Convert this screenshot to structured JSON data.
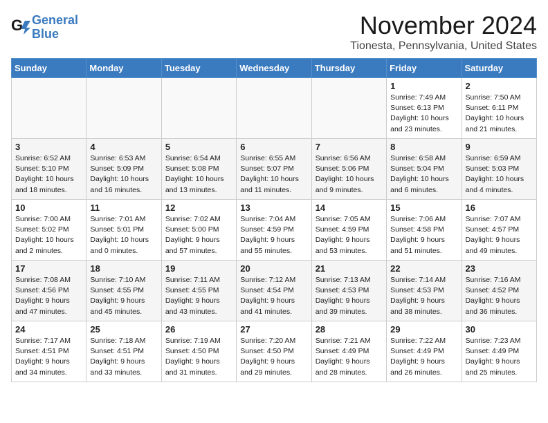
{
  "header": {
    "logo_line1": "General",
    "logo_line2": "Blue",
    "month": "November 2024",
    "location": "Tionesta, Pennsylvania, United States"
  },
  "weekdays": [
    "Sunday",
    "Monday",
    "Tuesday",
    "Wednesday",
    "Thursday",
    "Friday",
    "Saturday"
  ],
  "weeks": [
    [
      {
        "day": "",
        "info": ""
      },
      {
        "day": "",
        "info": ""
      },
      {
        "day": "",
        "info": ""
      },
      {
        "day": "",
        "info": ""
      },
      {
        "day": "",
        "info": ""
      },
      {
        "day": "1",
        "info": "Sunrise: 7:49 AM\nSunset: 6:13 PM\nDaylight: 10 hours\nand 23 minutes."
      },
      {
        "day": "2",
        "info": "Sunrise: 7:50 AM\nSunset: 6:11 PM\nDaylight: 10 hours\nand 21 minutes."
      }
    ],
    [
      {
        "day": "3",
        "info": "Sunrise: 6:52 AM\nSunset: 5:10 PM\nDaylight: 10 hours\nand 18 minutes."
      },
      {
        "day": "4",
        "info": "Sunrise: 6:53 AM\nSunset: 5:09 PM\nDaylight: 10 hours\nand 16 minutes."
      },
      {
        "day": "5",
        "info": "Sunrise: 6:54 AM\nSunset: 5:08 PM\nDaylight: 10 hours\nand 13 minutes."
      },
      {
        "day": "6",
        "info": "Sunrise: 6:55 AM\nSunset: 5:07 PM\nDaylight: 10 hours\nand 11 minutes."
      },
      {
        "day": "7",
        "info": "Sunrise: 6:56 AM\nSunset: 5:06 PM\nDaylight: 10 hours\nand 9 minutes."
      },
      {
        "day": "8",
        "info": "Sunrise: 6:58 AM\nSunset: 5:04 PM\nDaylight: 10 hours\nand 6 minutes."
      },
      {
        "day": "9",
        "info": "Sunrise: 6:59 AM\nSunset: 5:03 PM\nDaylight: 10 hours\nand 4 minutes."
      }
    ],
    [
      {
        "day": "10",
        "info": "Sunrise: 7:00 AM\nSunset: 5:02 PM\nDaylight: 10 hours\nand 2 minutes."
      },
      {
        "day": "11",
        "info": "Sunrise: 7:01 AM\nSunset: 5:01 PM\nDaylight: 10 hours\nand 0 minutes."
      },
      {
        "day": "12",
        "info": "Sunrise: 7:02 AM\nSunset: 5:00 PM\nDaylight: 9 hours\nand 57 minutes."
      },
      {
        "day": "13",
        "info": "Sunrise: 7:04 AM\nSunset: 4:59 PM\nDaylight: 9 hours\nand 55 minutes."
      },
      {
        "day": "14",
        "info": "Sunrise: 7:05 AM\nSunset: 4:59 PM\nDaylight: 9 hours\nand 53 minutes."
      },
      {
        "day": "15",
        "info": "Sunrise: 7:06 AM\nSunset: 4:58 PM\nDaylight: 9 hours\nand 51 minutes."
      },
      {
        "day": "16",
        "info": "Sunrise: 7:07 AM\nSunset: 4:57 PM\nDaylight: 9 hours\nand 49 minutes."
      }
    ],
    [
      {
        "day": "17",
        "info": "Sunrise: 7:08 AM\nSunset: 4:56 PM\nDaylight: 9 hours\nand 47 minutes."
      },
      {
        "day": "18",
        "info": "Sunrise: 7:10 AM\nSunset: 4:55 PM\nDaylight: 9 hours\nand 45 minutes."
      },
      {
        "day": "19",
        "info": "Sunrise: 7:11 AM\nSunset: 4:55 PM\nDaylight: 9 hours\nand 43 minutes."
      },
      {
        "day": "20",
        "info": "Sunrise: 7:12 AM\nSunset: 4:54 PM\nDaylight: 9 hours\nand 41 minutes."
      },
      {
        "day": "21",
        "info": "Sunrise: 7:13 AM\nSunset: 4:53 PM\nDaylight: 9 hours\nand 39 minutes."
      },
      {
        "day": "22",
        "info": "Sunrise: 7:14 AM\nSunset: 4:53 PM\nDaylight: 9 hours\nand 38 minutes."
      },
      {
        "day": "23",
        "info": "Sunrise: 7:16 AM\nSunset: 4:52 PM\nDaylight: 9 hours\nand 36 minutes."
      }
    ],
    [
      {
        "day": "24",
        "info": "Sunrise: 7:17 AM\nSunset: 4:51 PM\nDaylight: 9 hours\nand 34 minutes."
      },
      {
        "day": "25",
        "info": "Sunrise: 7:18 AM\nSunset: 4:51 PM\nDaylight: 9 hours\nand 33 minutes."
      },
      {
        "day": "26",
        "info": "Sunrise: 7:19 AM\nSunset: 4:50 PM\nDaylight: 9 hours\nand 31 minutes."
      },
      {
        "day": "27",
        "info": "Sunrise: 7:20 AM\nSunset: 4:50 PM\nDaylight: 9 hours\nand 29 minutes."
      },
      {
        "day": "28",
        "info": "Sunrise: 7:21 AM\nSunset: 4:49 PM\nDaylight: 9 hours\nand 28 minutes."
      },
      {
        "day": "29",
        "info": "Sunrise: 7:22 AM\nSunset: 4:49 PM\nDaylight: 9 hours\nand 26 minutes."
      },
      {
        "day": "30",
        "info": "Sunrise: 7:23 AM\nSunset: 4:49 PM\nDaylight: 9 hours\nand 25 minutes."
      }
    ]
  ]
}
